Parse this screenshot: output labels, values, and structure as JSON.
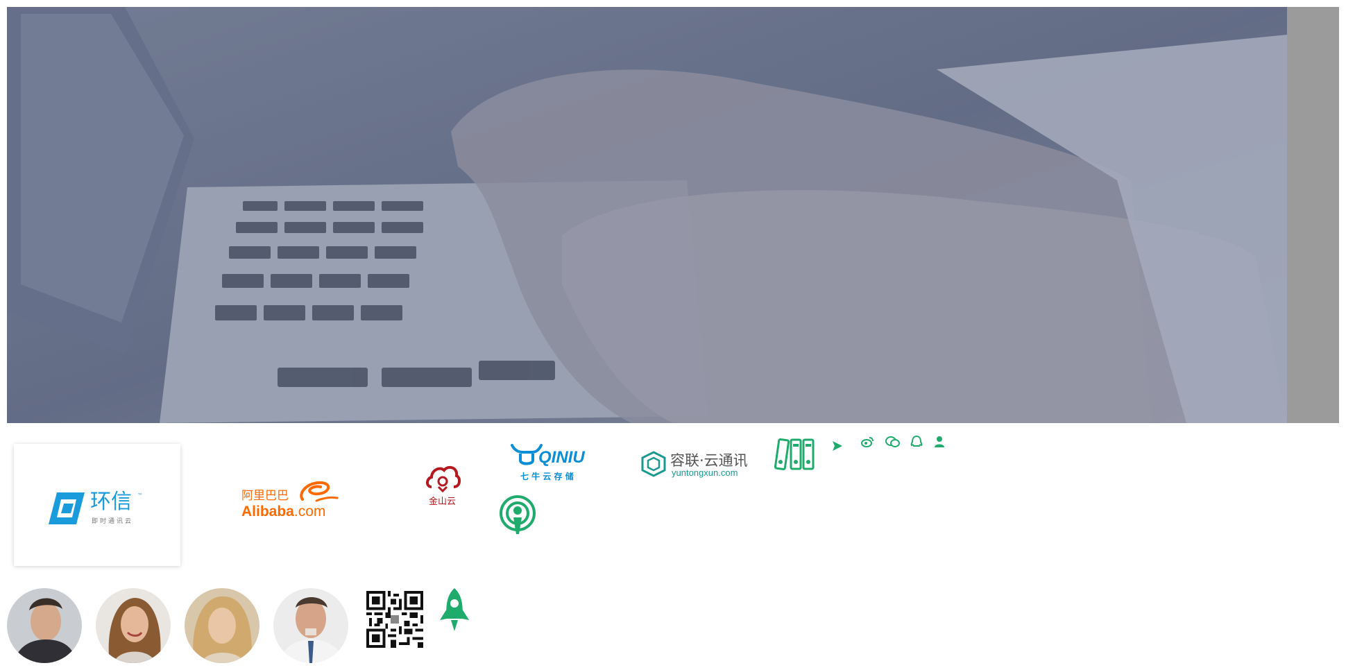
{
  "hero": {
    "alt": "hands-typing-on-laptop"
  },
  "logos": {
    "huanxin": {
      "name": "环信",
      "tm": "™",
      "tagline": "即时通讯云"
    },
    "alibaba": {
      "cn": "阿里巴巴",
      "en": "Alibaba",
      "suffix": ".com"
    },
    "kingsoft": {
      "name": "金山云"
    },
    "qiniu": {
      "en": "QINIU",
      "cn": "七 牛 云 存 储"
    },
    "ronglian": {
      "cn": "容联·云通讯",
      "domain": "yuntongxun.com"
    }
  },
  "icons": {
    "binders": "binders-icon",
    "play": "play-icon",
    "weibo": "weibo-icon",
    "wechat": "wechat-icon",
    "qq": "qq-icon",
    "user": "user-icon",
    "podcast": "podcast-icon",
    "rocket": "rocket-icon",
    "qr": "qr-code-icon"
  },
  "colors": {
    "accent_green": "#1fab6b",
    "huanxin_blue": "#1a9bdc",
    "alibaba_orange": "#ff6a00",
    "kingsoft_red": "#b5181e",
    "qiniu_blue": "#0a8fd6",
    "ronglian_teal": "#1a9a8e"
  },
  "avatars": [
    "man-avatar",
    "woman-smiling-avatar",
    "blonde-woman-avatar",
    "businessman-avatar"
  ]
}
